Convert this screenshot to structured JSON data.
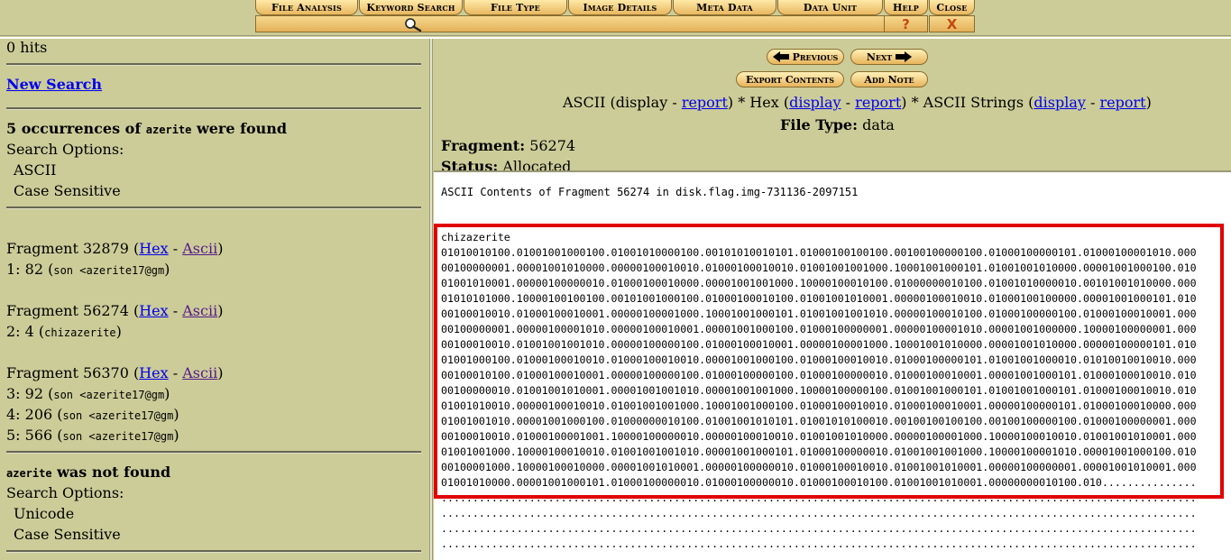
{
  "nav": {
    "tabs": [
      "File Analysis",
      "Keyword Search",
      "File Type",
      "Image Details",
      "Meta Data",
      "Data Unit",
      "Help",
      "Close"
    ],
    "help_glyph": "?",
    "close_glyph": "X",
    "active_icon": "magnifier-icon"
  },
  "left": {
    "hits": "0 hits",
    "new_search": "New Search",
    "result1": {
      "count_prefix": "5 occurrences of ",
      "keyword": "azerite",
      "count_suffix": " were found",
      "options_label": "Search Options:",
      "opt1": "ASCII",
      "opt2": "Case Sensitive"
    },
    "fragments": [
      {
        "label": "Fragment 32879 (",
        "hex": "Hex",
        "sep": " - ",
        "ascii": "Ascii",
        "close": ")",
        "hits": [
          {
            "prefix": "1: 82 (",
            "snippet": "son <azerite17@gm",
            "suffix": ")"
          }
        ]
      },
      {
        "label": "Fragment 56274 (",
        "hex": "Hex",
        "sep": " - ",
        "ascii": "Ascii",
        "close": ")",
        "hits": [
          {
            "prefix": "2: 4 (",
            "snippet": "chizazerite",
            "suffix": ")"
          }
        ]
      },
      {
        "label": "Fragment 56370 (",
        "hex": "Hex",
        "sep": " - ",
        "ascii": "Ascii",
        "close": ")",
        "hits": [
          {
            "prefix": "3: 92 (",
            "snippet": "son <azerite17@gm",
            "suffix": ")"
          },
          {
            "prefix": "4: 206 (",
            "snippet": "son <azerite17@gm",
            "suffix": ")"
          },
          {
            "prefix": "5: 566 (",
            "snippet": "son <azerite17@gm",
            "suffix": ")"
          }
        ]
      }
    ],
    "result2": {
      "keyword": "azerite",
      "suffix": " was not found",
      "options_label": "Search Options:",
      "opt1": "Unicode",
      "opt2": "Case Sensitive"
    }
  },
  "right": {
    "previous": "Previous",
    "next": "Next",
    "export": "Export Contents",
    "add_note": "Add Note",
    "views": {
      "ascii": "ASCII (display - ",
      "ascii_report": "report",
      "hex_pre": ") * Hex (",
      "hex_display": "display",
      "dash1": " - ",
      "hex_report": "report",
      "str_pre": ") * ASCII Strings (",
      "str_display": "display",
      "dash2": " - ",
      "str_report": "report",
      "end": ")"
    },
    "file_type_label": "File Type:",
    "file_type_value": " data",
    "fragment_label": "Fragment:",
    "fragment_value": " 56274",
    "status_label": "Status:",
    "status_value": " Allocated",
    "contents_heading": "ASCII Contents of Fragment 56274 in disk.flag.img-731136-2097151",
    "dump_lines": [
      "chizazerite",
      "01010010100.01001001000100.01001010000100.00101010010101.01000100100100.00100100000100.01000100000101.01000100001010.000",
      "00100000001.00001001010000.00000100010010.01000100010010.01001001001000.10001001000101.01001001010000.00001001000100.010",
      "01001010001.00000100000010.01000100010000.00001001001000.10000100010100.01000000010100.01001010000010.00101001010000.000",
      "01010101000.10000100100100.00101001000100.01000100010100.01001001010001.00000100010010.01000100100000.00001001000101.010",
      "00100010010.01000100010001.00000100001000.10001001000101.01001001001010.00000100010100.01000100000100.01000100010001.000",
      "00100000001.00000100001010.00000100010001.00001001000100.01000100000001.00000100001010.00001001000000.10000100000001.000",
      "00100010010.01001001001010.00000100000100.01000100010001.00000100001000.10001001010000.00001001010000.00000100000101.010",
      "01001000100.01000100010010.01000100010010.00001001000100.01000100010010.01000100000101.01001001000010.01010010010010.000",
      "00100010100.01000100010001.00000100000100.01000100000100.01000100000010.01000100010001.00001001000101.01000100010010.010",
      "00100000010.01001001010001.00001001001010.00001001001000.10000100000100.01001001000101.01001001000101.01000100010010.010",
      "01001010010.00000100010010.01001001001000.10001001000100.01000100010010.01000100010001.00000100000101.01000100010000.000",
      "01001001010.00001001000100.01000000010100.01001001010101.01001010100010.00100100100100.00100100000100.01000100000001.000",
      "00100010010.01000100001001.10000100000010.00000100010010.01001001010000.00000100001000.10000100010010.01001001010001.000",
      "01001001000.10000100010010.01001001001010.00001001000101.01000100000010.01001001001000.10000100001010.00001001000100.010",
      "00100001000.10000100010000.00001001010001.00000100000010.01000100010010.01001001010001.00000100000001.00001001010001.000",
      "01001010000.00001001000101.01000100000010.01000100000010.01000100010100.01001001010001.00000000010100.010...............",
      "........................................................................................................................",
      "........................................................................................................................",
      "........................................................................................................................",
      "........................................................................................................................"
    ]
  }
}
